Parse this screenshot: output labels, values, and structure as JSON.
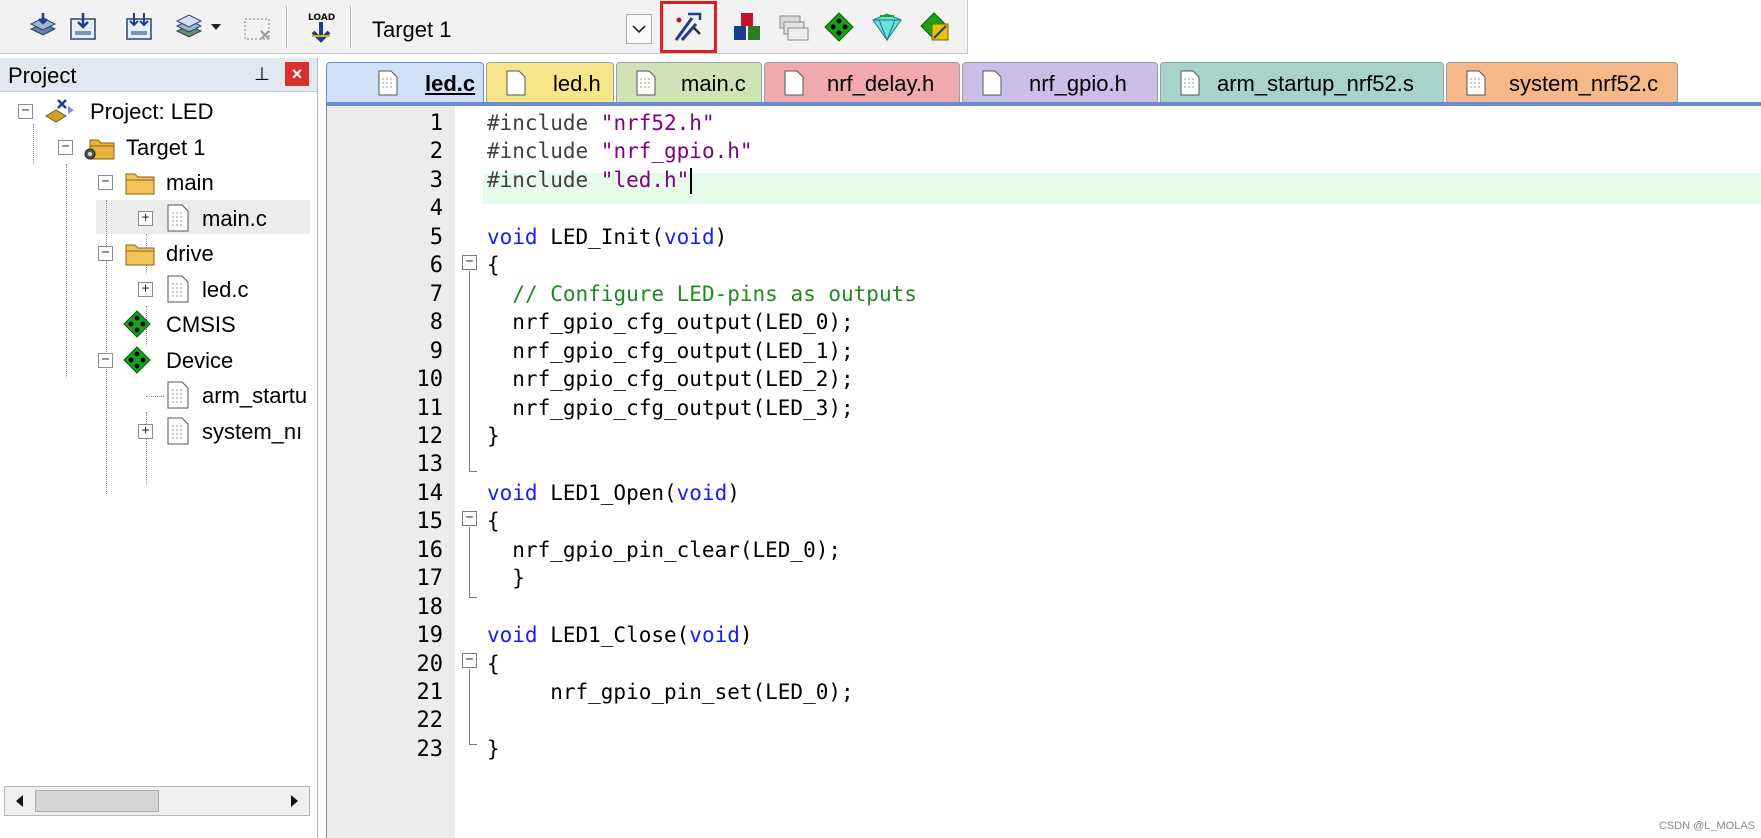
{
  "toolbar": {
    "buttons": [
      {
        "name": "translate-file-icon"
      },
      {
        "name": "build-target-icon"
      },
      {
        "name": "rebuild-all-icon"
      },
      {
        "name": "batch-build-icon"
      },
      {
        "name": "stop-build-icon"
      },
      {
        "name": "download-load-icon",
        "caption": "LOAD"
      },
      {
        "name": "options-for-target-icon"
      },
      {
        "name": "manage-components-icon"
      },
      {
        "name": "manage-project-items-icon"
      },
      {
        "name": "select-packs-icon"
      },
      {
        "name": "pack-installer-icon"
      },
      {
        "name": "manage-run-time-environment-icon"
      }
    ],
    "target_value": "Target 1",
    "highlight_color": "#e02020"
  },
  "project_pane": {
    "title": "Project",
    "pin_glyph": "⊥",
    "close_glyph": "×",
    "tree": [
      {
        "label": "Project: LED",
        "icon": "project-icon",
        "level": 0,
        "expand": "minus"
      },
      {
        "label": "Target 1",
        "icon": "target-folder-icon",
        "level": 1,
        "expand": "minus",
        "selected": true
      },
      {
        "label": "main",
        "icon": "folder-icon",
        "level": 2,
        "expand": "minus"
      },
      {
        "label": "main.c",
        "icon": "file-icon",
        "level": 3,
        "expand": "plus"
      },
      {
        "label": "drive",
        "icon": "folder-icon",
        "level": 2,
        "expand": "minus"
      },
      {
        "label": "led.c",
        "icon": "file-icon",
        "level": 3,
        "expand": "plus"
      },
      {
        "label": "CMSIS",
        "icon": "cmsis-diamond-icon",
        "level": 2,
        "expand": "none"
      },
      {
        "label": "Device",
        "icon": "device-diamond-icon",
        "level": 2,
        "expand": "minus"
      },
      {
        "label": "arm_startu",
        "icon": "file-icon",
        "level": 3,
        "expand": "none"
      },
      {
        "label": "system_nı",
        "icon": "file-icon",
        "level": 3,
        "expand": "plus"
      }
    ]
  },
  "tabs": [
    {
      "label": "led.c",
      "color": "#cfe0f7",
      "active": true
    },
    {
      "label": "led.h",
      "color": "#f7e58a"
    },
    {
      "label": "main.c",
      "color": "#cfe3b6"
    },
    {
      "label": "nrf_delay.h",
      "color": "#f0a9ad"
    },
    {
      "label": "nrf_gpio.h",
      "color": "#c9bfe9"
    },
    {
      "label": "arm_startup_nrf52.s",
      "color": "#a8d3cb"
    },
    {
      "label": "system_nrf52.c",
      "color": "#f7b889"
    }
  ],
  "editor": {
    "lines": [
      {
        "n": "1",
        "parts": [
          [
            "pp",
            "#include "
          ],
          [
            "str",
            "\"nrf52.h\""
          ]
        ]
      },
      {
        "n": "2",
        "parts": [
          [
            "pp",
            "#include "
          ],
          [
            "str",
            "\"nrf_gpio.h\""
          ]
        ]
      },
      {
        "n": "3",
        "parts": [
          [
            "pp",
            "#include "
          ],
          [
            "str",
            "\"led.h\""
          ]
        ],
        "current": true
      },
      {
        "n": "4",
        "parts": []
      },
      {
        "n": "5",
        "parts": [
          [
            "kw",
            "void"
          ],
          [
            "",
            " LED_Init("
          ],
          [
            "kw",
            "void"
          ],
          [
            "",
            ")"
          ]
        ]
      },
      {
        "n": "6",
        "parts": [
          [
            "",
            "{"
          ]
        ]
      },
      {
        "n": "7",
        "parts": [
          [
            "",
            "  "
          ],
          [
            "cmt",
            "// Configure LED-pins as outputs"
          ]
        ]
      },
      {
        "n": "8",
        "parts": [
          [
            "",
            "  nrf_gpio_cfg_output(LED_0);"
          ]
        ]
      },
      {
        "n": "9",
        "parts": [
          [
            "",
            "  nrf_gpio_cfg_output(LED_1);"
          ]
        ]
      },
      {
        "n": "10",
        "parts": [
          [
            "",
            "  nrf_gpio_cfg_output(LED_2);"
          ]
        ]
      },
      {
        "n": "11",
        "parts": [
          [
            "",
            "  nrf_gpio_cfg_output(LED_3);"
          ]
        ]
      },
      {
        "n": "12",
        "parts": [
          [
            "",
            "}"
          ]
        ]
      },
      {
        "n": "13",
        "parts": []
      },
      {
        "n": "14",
        "parts": [
          [
            "kw",
            "void"
          ],
          [
            "",
            " LED1_Open("
          ],
          [
            "kw",
            "void"
          ],
          [
            "",
            ")"
          ]
        ]
      },
      {
        "n": "15",
        "parts": [
          [
            "",
            "{"
          ]
        ]
      },
      {
        "n": "16",
        "parts": [
          [
            "",
            "  nrf_gpio_pin_clear(LED_0);"
          ]
        ]
      },
      {
        "n": "17",
        "parts": [
          [
            "",
            "  }"
          ]
        ]
      },
      {
        "n": "18",
        "parts": []
      },
      {
        "n": "19",
        "parts": [
          [
            "kw",
            "void"
          ],
          [
            "",
            " LED1_Close("
          ],
          [
            "kw",
            "void"
          ],
          [
            "",
            ")"
          ]
        ]
      },
      {
        "n": "20",
        "parts": [
          [
            "",
            "{"
          ]
        ]
      },
      {
        "n": "21",
        "parts": [
          [
            "",
            "     nrf_gpio_pin_set(LED_0);"
          ]
        ]
      },
      {
        "n": "22",
        "parts": []
      },
      {
        "n": "23",
        "parts": [
          [
            "",
            "}"
          ]
        ]
      }
    ],
    "colors": {
      "keyword": "#1a1aff",
      "string": "#800080",
      "comment": "#1f8a1f",
      "current_line": "#e6fbe9"
    }
  },
  "watermark": "CSDN @L_MOLAS"
}
